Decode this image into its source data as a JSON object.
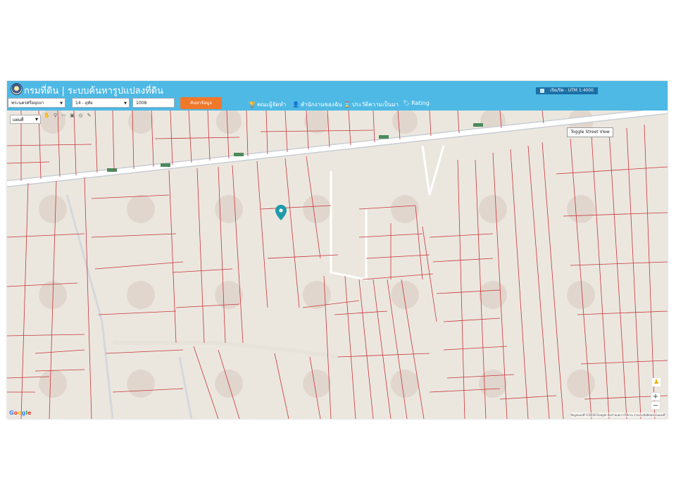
{
  "header": {
    "title": "กรมที่ดิน | ระบบค้นหารูปแปลงที่ดิน",
    "province_select": "พระนครศรีอยุธยา",
    "district_select": "14 - อุทัย",
    "parcel_input": "1008",
    "search_label": "ค้นหาข้อมูล",
    "nav_items": [
      {
        "label": "คณะผู้จัดทำ",
        "icon": "trophy-icon"
      },
      {
        "label": "สำนักงานของฉัน",
        "icon": "user-icon"
      },
      {
        "label": "ประวัติความเป็นมา",
        "icon": "hourglass-icon"
      },
      {
        "label": "Rating",
        "icon": "tag-icon"
      }
    ],
    "scale_label": "เปิด/ปิด - UTM 1:4000"
  },
  "map": {
    "basemap_select": "แผนที่",
    "toggle_street_view": "Toggle Street View",
    "zoom_in": "+",
    "zoom_out": "−",
    "google_logo": "Google",
    "attribution": "ข้อมูลแผนที่ ©2018 Google   ข้อกำหนดการใช้งาน   รายงานข้อผิดพลาดแผนที่",
    "tools": [
      "hand-icon",
      "pin-tool-icon",
      "line-tool-icon",
      "polygon-tool-icon",
      "circle-tool-icon",
      "measure-tool-icon"
    ],
    "road_labels": [
      "3469",
      "3469",
      "3469",
      "3469",
      "3469"
    ],
    "colors": {
      "parcel_line": "#c8353a",
      "map_bg": "#ebe7df",
      "road": "#ffffff",
      "header": "#4eb9e5",
      "marker": "#1f9aa8"
    }
  }
}
